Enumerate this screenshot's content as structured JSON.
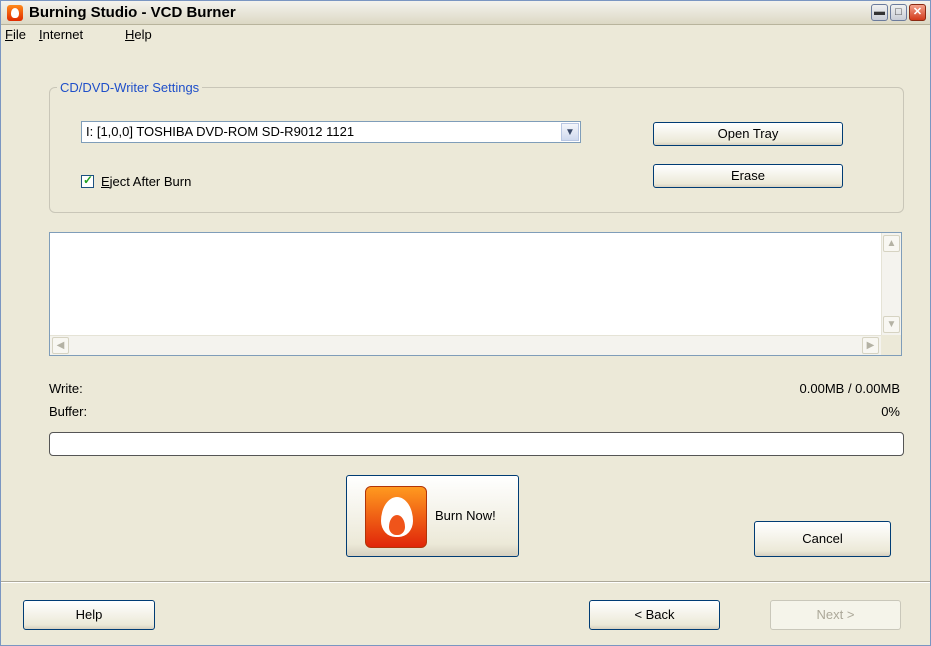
{
  "window": {
    "title": "Burning Studio - VCD Burner",
    "controls": {
      "minimize_glyph": "▬",
      "maximize_glyph": "□",
      "close_glyph": "✕"
    }
  },
  "menubar": {
    "items": [
      {
        "mnemonic": "F",
        "rest": "ile"
      },
      {
        "mnemonic": "I",
        "rest": "nternet"
      },
      {
        "mnemonic": "H",
        "rest": "elp"
      }
    ]
  },
  "settings": {
    "group_title": "CD/DVD-Writer Settings",
    "drive_selected": "I: [1,0,0] TOSHIBA  DVD-ROM SD-R9012 1121",
    "eject_after_burn": {
      "label_mnemonic": "E",
      "label_rest": "ject After Burn",
      "checked": true
    },
    "open_tray_label": "Open Tray",
    "erase_label": "Erase"
  },
  "log": {
    "lines": []
  },
  "status": {
    "write_label": "Write:",
    "write_value": "0.00MB / 0.00MB",
    "buffer_label": "Buffer:",
    "buffer_value": "0%",
    "progress_fraction": 0.0
  },
  "actions": {
    "burn_now_label": "Burn Now!",
    "cancel_label": "Cancel"
  },
  "footer": {
    "help_label": "Help",
    "back_label": "< Back",
    "next_label": "Next >",
    "next_enabled": false
  },
  "colors": {
    "accent_legend": "#1f4fc9",
    "window_face": "#ece9d8",
    "burn_icon": "#e0250a"
  }
}
